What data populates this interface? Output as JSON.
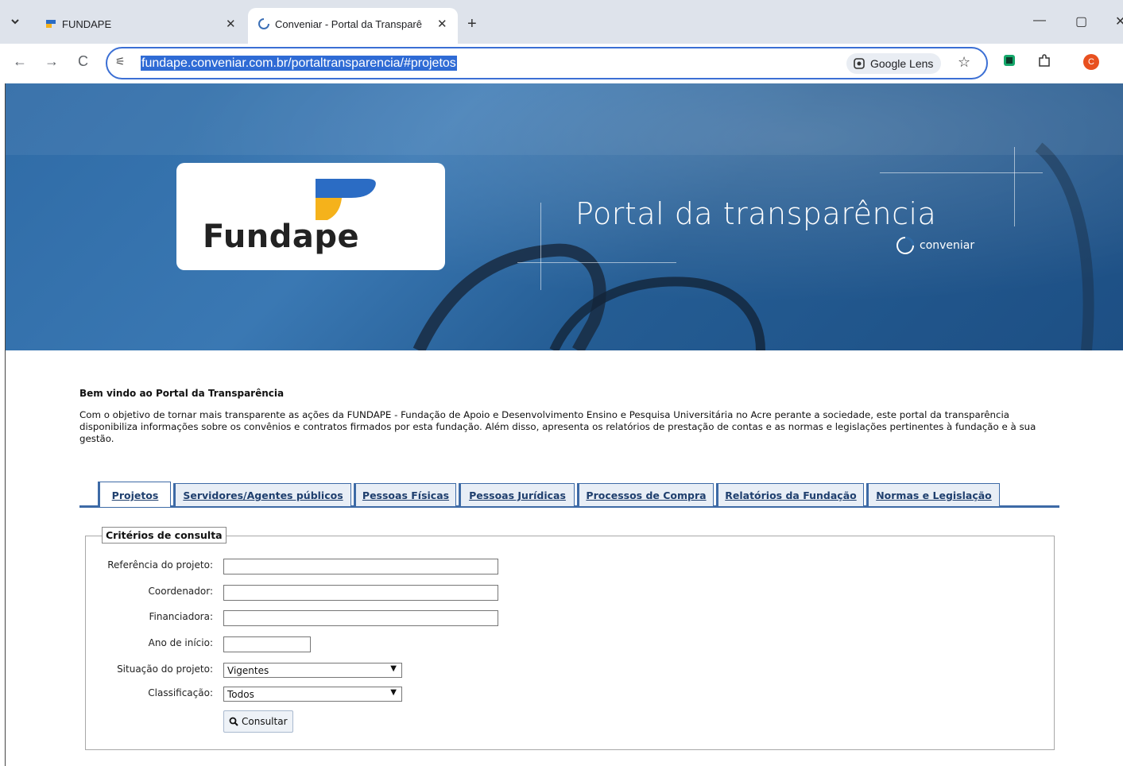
{
  "browser": {
    "tabs": [
      {
        "title": "FUNDAPE",
        "active": false
      },
      {
        "title": "Conveniar - Portal da Transparê",
        "active": true
      }
    ],
    "url": "fundape.conveniar.com.br/portaltransparencia/#projetos",
    "lens_label": "Google Lens",
    "profile_initial": "C"
  },
  "banner": {
    "logo_text": "Fundape",
    "title": "Portal da transparência",
    "brand": "conveniar"
  },
  "page": {
    "welcome": "Bem vindo ao Portal da Transparência",
    "intro": "Com o objetivo de tornar mais transparente as ações da FUNDAPE - Fundação de Apoio e Desenvolvimento Ensino e Pesquisa Universitária no Acre perante a sociedade, este portal da transparência disponibiliza informações sobre os convênios e contratos firmados por esta fundação. Além disso, apresenta os relatórios de prestação de contas e as normas e legislações pertinentes à fundação e à sua gestão.",
    "tabs": [
      {
        "label": "Projetos",
        "active": true
      },
      {
        "label": "Servidores/Agentes públicos",
        "active": false
      },
      {
        "label": "Pessoas Físicas",
        "active": false
      },
      {
        "label": "Pessoas Jurídicas",
        "active": false
      },
      {
        "label": "Processos de Compra",
        "active": false
      },
      {
        "label": "Relatórios da Fundação",
        "active": false
      },
      {
        "label": "Normas e Legislação",
        "active": false
      }
    ]
  },
  "form": {
    "legend": "Critérios de consulta",
    "fields": {
      "referencia": {
        "label": "Referência do projeto:",
        "value": ""
      },
      "coordenador": {
        "label": "Coordenador:",
        "value": ""
      },
      "financiadora": {
        "label": "Financiadora:",
        "value": ""
      },
      "ano": {
        "label": "Ano de início:",
        "value": ""
      },
      "situacao": {
        "label": "Situação do projeto:",
        "value": "Vigentes"
      },
      "classificacao": {
        "label": "Classificação:",
        "value": "Todos"
      }
    },
    "submit_label": "Consultar"
  }
}
